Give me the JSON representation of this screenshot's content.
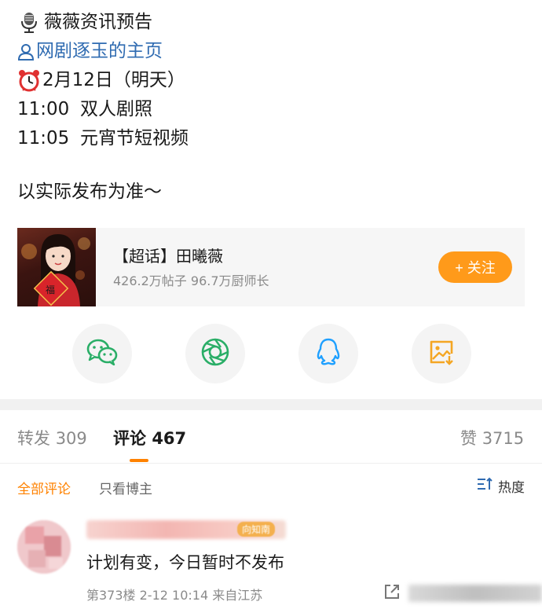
{
  "post": {
    "line1": "薇薇资讯预告",
    "line2": "网剧逐玉的主页",
    "line3": "2月12日（明天）",
    "schedule": [
      {
        "time": "11:00",
        "item": "双人剧照"
      },
      {
        "time": "11:05",
        "item": "元宵节短视频"
      }
    ],
    "note": "以实际发布为准～"
  },
  "supertopic": {
    "title": "【超话】田曦薇",
    "stats": "426.2万帖子 96.7万厨师长",
    "follow_label": "+ 关注"
  },
  "share": {
    "items": [
      "wechat-icon",
      "moments-icon",
      "qq-icon",
      "save-image-icon"
    ],
    "colors": {
      "wechat": "#2aae67",
      "moments": "#2aae67",
      "qq": "#1fa0ff",
      "save": "#f4a623"
    }
  },
  "tabs": {
    "repost_label": "转发",
    "repost_count": "309",
    "comment_label": "评论",
    "comment_count": "467",
    "like_label": "赞",
    "like_count": "3715"
  },
  "filter": {
    "all_label": "全部评论",
    "owner_label": "只看博主",
    "sort_label": "热度"
  },
  "comment": {
    "badge": "向知南",
    "text": "计划有变，今日暂时不发布",
    "meta": "第373楼 2-12 10:14 来自江苏"
  },
  "colors": {
    "accent": "#ff8200",
    "link": "#2f6bb1",
    "follow_btn": "#ff9a1a"
  }
}
